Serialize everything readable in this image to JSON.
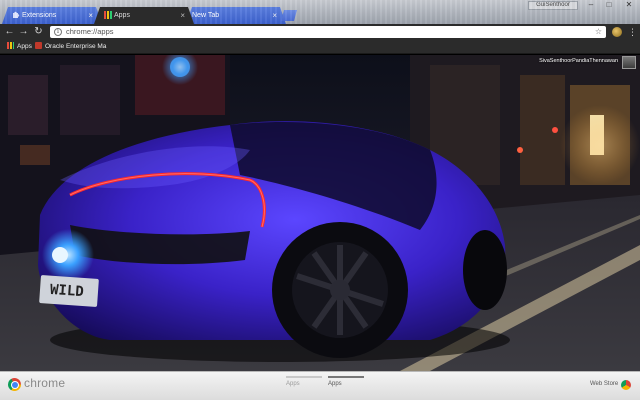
{
  "window": {
    "profile_name": "GuiSenthoor",
    "controls": {
      "minimize": "–",
      "maximize": "□",
      "close": "✕"
    }
  },
  "tabs": [
    {
      "title": "Extensions",
      "icon": "puzzle-icon",
      "state": "inactive"
    },
    {
      "title": "Apps",
      "icon": "apps-grid-icon",
      "state": "active"
    },
    {
      "title": "New Tab",
      "icon": "none",
      "state": "inactive"
    }
  ],
  "toolbar": {
    "back": "←",
    "forward": "→",
    "reload": "↻",
    "url": "chrome://apps",
    "star": "☆",
    "menu": "⋮"
  },
  "bookmarks": [
    {
      "label": "Apps",
      "icon": "apps-grid-icon"
    },
    {
      "label": "Oracle Enterprise Ma",
      "icon": "oracle-icon"
    }
  ],
  "content": {
    "wallpaper": "night-street-purple-supercar",
    "user_label": "SivaSenthoorPandiaThennawan",
    "plate": "WILD"
  },
  "footer": {
    "logo_text": "chrome",
    "pages": [
      {
        "label": "Apps",
        "selected": false
      },
      {
        "label": "Apps",
        "selected": true
      }
    ],
    "webstore": "Web Store"
  },
  "colors": {
    "tab_inactive": "#3c61cf",
    "tab_active": "#2b2b2b",
    "toolbar": "#2b2b2b",
    "car_body": "#3a22c8",
    "tail_light": "#ff2a2a",
    "exhaust_glow": "#3aa0ff"
  }
}
